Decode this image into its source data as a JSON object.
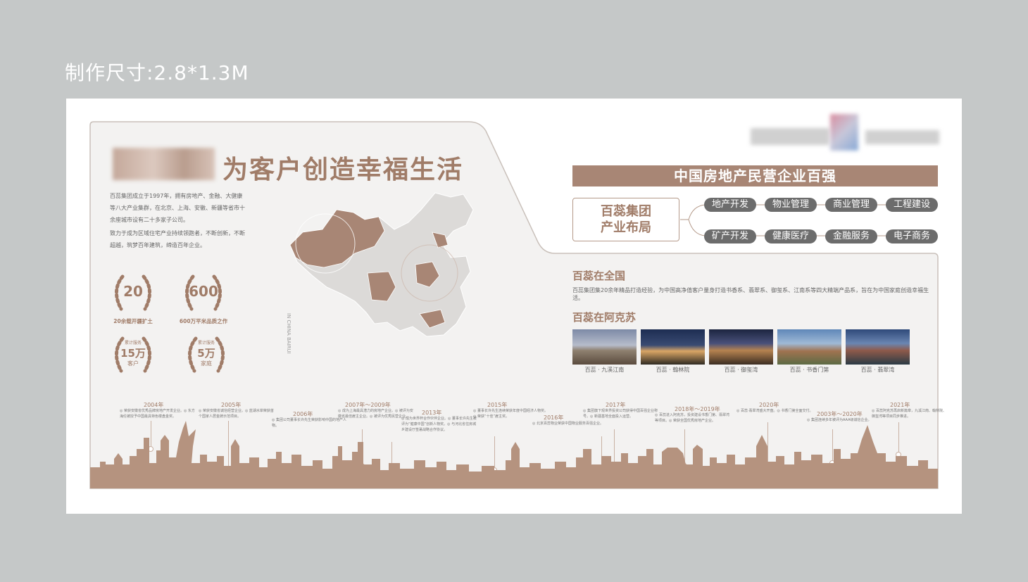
{
  "size_label": "制作尺寸:2.8*1.3M",
  "slogan": "为客户创造幸福生活",
  "intro": [
    "百蕊集团成立于1997年，拥有房地产、金融、大健康等八大产业集群，在北京、上海、安徽、新疆等省市十余座城市设有二十多家子公司。",
    "致力于成为区域住宅产业持续领跑者，不断创新，不断超越，筑梦百年建筑，缔造百年企业。"
  ],
  "badges": [
    {
      "num": "20",
      "caption": "20余载开疆扩土",
      "top": ""
    },
    {
      "num": "600",
      "caption": "600万平米品质之作",
      "top": ""
    },
    {
      "num": "15万",
      "caption": "客户",
      "top": "累计服务"
    },
    {
      "num": "5万",
      "caption": "家庭",
      "top": "累计服务"
    }
  ],
  "map_label": "IN CHINA BAIRUI",
  "hundred_title": "中国房地产民营企业百强",
  "layout_title": "百蕊集团\n产业布局",
  "layout_line1": "百蕊集团",
  "layout_line2": "产业布局",
  "industries_row1": [
    "地产开发",
    "物业管理",
    "商业管理",
    "工程建设"
  ],
  "industries_row2": [
    "矿产开发",
    "健康医疗",
    "金融服务",
    "电子商务"
  ],
  "national_title": "百蕊在全国",
  "national_desc": "百蕊集团集20余年精品打造经验，为中国高净值客户量身打造书香系、翡翠系、御玺系、江南系等四大精端产品系，旨在为中国家庭创造幸福生活。",
  "aksu_title": "百蕊在阿克苏",
  "projects": [
    "百蕊 · 九溪江南",
    "百蕊 · 翰林院",
    "百蕊 · 御玺湾",
    "百蕊 · 书香门第",
    "百蕊 · 翡翠湾"
  ],
  "timeline": [
    {
      "year": "2004年",
      "text": "◎ 荣获安徽省优秀品牌房地产开发企业。◎ 东方海伦被授予中国最具特色楼盘金奖。"
    },
    {
      "year": "2005年",
      "text": "◎ 荣获安徽省诚信经营企业。◎ 蓝湖水岸荣获首个国家人居金牌示范项目。"
    },
    {
      "year": "2006年",
      "text": "◎ 集团公司董事长许先生荣获影响中国的地产人物。"
    },
    {
      "year": "2007年～2009年",
      "text": "◎ 成为上海最具潜力的房地产企业。◎ 被评为安徽省最佳雇主企业。◎ 被评为优秀民营企业。"
    },
    {
      "year": "2013年",
      "text": "◎ 成为世界杯合作伙伴企业。◎ 董事长许先生被评为“健康中国”创新人物奖。◎ 与河北省住房城乡建设厅签署战略合作协议。"
    },
    {
      "year": "2015年",
      "text": "◎ 董事长许先生连续荣获年度中国经济人物奖。◎ 荣获“十佳”雇主奖。"
    },
    {
      "year": "2016年",
      "text": "◎ 北京百蕊物业荣获中国物业服务百强企业。"
    },
    {
      "year": "2017年",
      "text": "◎ 集团旗下观世界投资公司获得中国百强企业称号。◎ 新疆基地全面投入运营。"
    },
    {
      "year": "2018年～2019年",
      "text": "◎ 百蕊进入阿克苏，投资建设书香门第、翡翠湾等项目。◎ 荣获全国优秀房地产企业。"
    },
    {
      "year": "2020年",
      "text": "◎ 百蕊·翡翠湾盛大开盘。◎ 书香门第全面交付。"
    },
    {
      "year": "2003年～2020年",
      "text": "◎ 集团连续多年被评为AAA级诚信企业。"
    },
    {
      "year": "2021年",
      "text": "◎ 百蕊阿克苏再启新篇章，九溪江南、翰林院、御玺湾等项目同步推进。"
    }
  ],
  "colors": {
    "accent": "#a07c68",
    "band": "#a88675",
    "pill": "#6c6c6c",
    "map": "#a88675",
    "skyline": "#b5937f"
  }
}
